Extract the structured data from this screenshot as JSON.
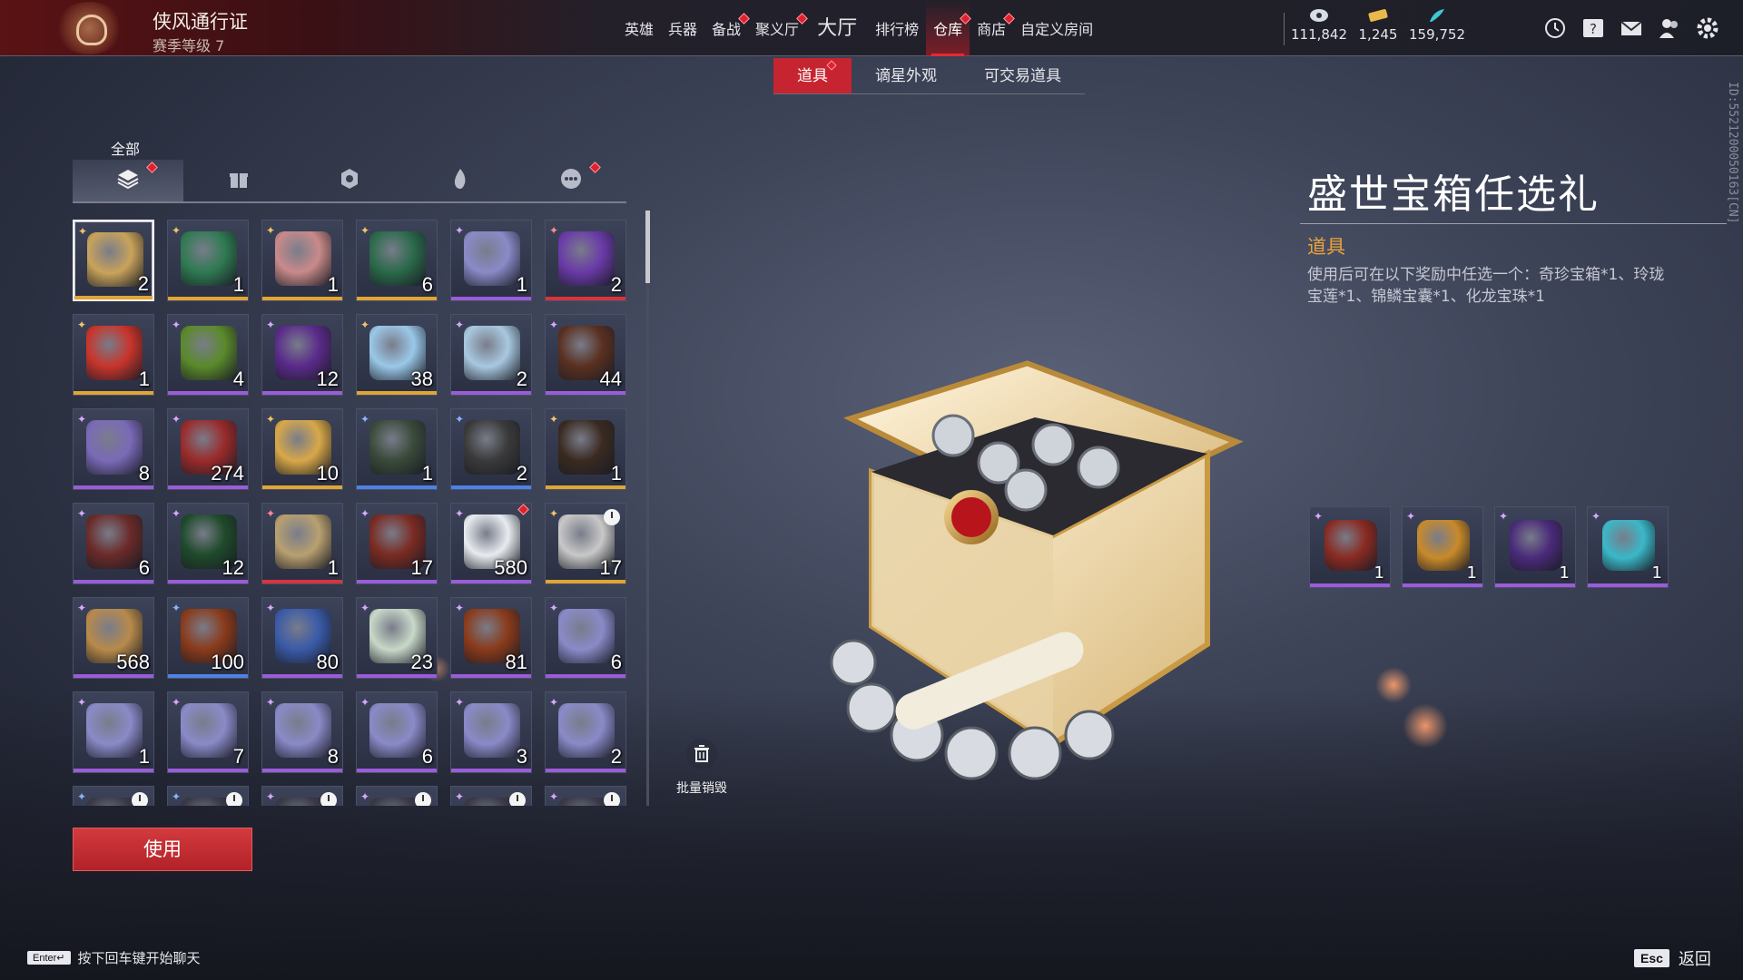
{
  "topbar": {
    "pass_title": "侠风通行证",
    "pass_level": "赛季等级 7",
    "nav": [
      {
        "label": "英雄",
        "dot": false,
        "big": false,
        "active": false
      },
      {
        "label": "兵器",
        "dot": false,
        "big": false,
        "active": false
      },
      {
        "label": "备战",
        "dot": true,
        "big": false,
        "active": false
      },
      {
        "label": "聚义厅",
        "dot": true,
        "big": false,
        "active": false
      },
      {
        "label": "大厅",
        "dot": false,
        "big": true,
        "active": false
      },
      {
        "label": "排行榜",
        "dot": false,
        "big": false,
        "active": false
      },
      {
        "label": "仓库",
        "dot": true,
        "big": false,
        "active": true
      },
      {
        "label": "商店",
        "dot": true,
        "big": false,
        "active": false
      },
      {
        "label": "自定义房间",
        "dot": false,
        "big": false,
        "active": false
      }
    ],
    "currencies": [
      {
        "icon": "jade-coin-icon",
        "value": "111,842"
      },
      {
        "icon": "gold-ticket-icon",
        "value": "1,245"
      },
      {
        "icon": "feather-icon",
        "value": "159,752"
      }
    ],
    "system_icons": [
      "clock-icon",
      "help-icon",
      "mail-icon",
      "friends-icon",
      "settings-icon"
    ]
  },
  "subtabs": [
    {
      "label": "道具",
      "active": true,
      "dot": true
    },
    {
      "label": "谪星外观",
      "active": false,
      "dot": false
    },
    {
      "label": "可交易道具",
      "active": false,
      "dot": false
    }
  ],
  "categories": {
    "active_label": "全部",
    "items": [
      {
        "icon": "all-items-stack-icon",
        "active": true,
        "dot": true
      },
      {
        "icon": "gift-icon",
        "active": false,
        "dot": false
      },
      {
        "icon": "badge-icon",
        "active": false,
        "dot": false
      },
      {
        "icon": "flame-icon",
        "active": false,
        "dot": false
      },
      {
        "icon": "more-icon",
        "active": false,
        "dot": true
      }
    ]
  },
  "inventory": [
    {
      "qty": "2",
      "rarity": "gold",
      "mark": "g",
      "color": "#c9a35a",
      "selected": true
    },
    {
      "qty": "1",
      "rarity": "gold",
      "mark": "g",
      "color": "#2f7a52"
    },
    {
      "qty": "1",
      "rarity": "gold",
      "mark": "g",
      "color": "#c98a8a"
    },
    {
      "qty": "6",
      "rarity": "gold",
      "mark": "g",
      "color": "#2a6a4a"
    },
    {
      "qty": "1",
      "rarity": "purple",
      "mark": "p",
      "color": "#8a8ac8"
    },
    {
      "qty": "2",
      "rarity": "red",
      "mark": "r",
      "color": "#6a3aa8"
    },
    {
      "qty": "1",
      "rarity": "gold",
      "mark": "g",
      "color": "#c8342a"
    },
    {
      "qty": "4",
      "rarity": "purple",
      "mark": "p",
      "color": "#5a8a2a"
    },
    {
      "qty": "12",
      "rarity": "purple",
      "mark": "p",
      "color": "#5a2a8a"
    },
    {
      "qty": "38",
      "rarity": "gold",
      "mark": "g",
      "color": "#9ac8e8"
    },
    {
      "qty": "2",
      "rarity": "purple",
      "mark": "p",
      "color": "#a8c8e0"
    },
    {
      "qty": "44",
      "rarity": "purple",
      "mark": "p",
      "color": "#5a3020"
    },
    {
      "qty": "8",
      "rarity": "purple",
      "mark": "p",
      "color": "#7a6ab8"
    },
    {
      "qty": "274",
      "rarity": "purple",
      "mark": "p",
      "color": "#9a2a2a"
    },
    {
      "qty": "10",
      "rarity": "gold",
      "mark": "g",
      "color": "#d8a848"
    },
    {
      "qty": "1",
      "rarity": "blue",
      "mark": "b",
      "color": "#3a4a3a"
    },
    {
      "qty": "2",
      "rarity": "blue",
      "mark": "b",
      "color": "#3a3a3a"
    },
    {
      "qty": "1",
      "rarity": "gold",
      "mark": "g",
      "color": "#3a2a20"
    },
    {
      "qty": "6",
      "rarity": "purple",
      "mark": "p",
      "color": "#6a2a28"
    },
    {
      "qty": "12",
      "rarity": "purple",
      "mark": "p",
      "color": "#1e4a2a"
    },
    {
      "qty": "1",
      "rarity": "red",
      "mark": "r",
      "color": "#b8a070"
    },
    {
      "qty": "17",
      "rarity": "purple",
      "mark": "p",
      "color": "#7a2a22"
    },
    {
      "qty": "580",
      "rarity": "purple",
      "mark": "p",
      "color": "#e8ecf0",
      "dot": true
    },
    {
      "qty": "17",
      "rarity": "gold",
      "mark": "g",
      "color": "#c8c8c8",
      "clock": true
    },
    {
      "qty": "568",
      "rarity": "purple",
      "mark": "p",
      "color": "#b88a4a"
    },
    {
      "qty": "100",
      "rarity": "blue",
      "mark": "b",
      "color": "#8a3a1a"
    },
    {
      "qty": "80",
      "rarity": "purple",
      "mark": "p",
      "color": "#3a5aa8"
    },
    {
      "qty": "23",
      "rarity": "purple",
      "mark": "p",
      "color": "#c8d8c8"
    },
    {
      "qty": "81",
      "rarity": "purple",
      "mark": "p",
      "color": "#8a3a1a"
    },
    {
      "qty": "6",
      "rarity": "purple",
      "mark": "p",
      "color": "#8a8ac8"
    },
    {
      "qty": "1",
      "rarity": "purple",
      "mark": "p",
      "color": "#8a8ac8"
    },
    {
      "qty": "7",
      "rarity": "purple",
      "mark": "p",
      "color": "#8a8ac8"
    },
    {
      "qty": "8",
      "rarity": "purple",
      "mark": "p",
      "color": "#8a8ac8"
    },
    {
      "qty": "6",
      "rarity": "purple",
      "mark": "p",
      "color": "#8a8ac8"
    },
    {
      "qty": "3",
      "rarity": "purple",
      "mark": "p",
      "color": "#8a8ac8"
    },
    {
      "qty": "2",
      "rarity": "purple",
      "mark": "p",
      "color": "#8a8ac8"
    },
    {
      "qty": "",
      "rarity": "blue",
      "mark": "b",
      "color": "#3a3a48",
      "clock": true
    },
    {
      "qty": "",
      "rarity": "blue",
      "mark": "b",
      "color": "#3a3a48",
      "clock": true
    },
    {
      "qty": "",
      "rarity": "purple",
      "mark": "p",
      "color": "#3a3a48",
      "clock": true
    },
    {
      "qty": "",
      "rarity": "purple",
      "mark": "p",
      "color": "#3a3a48",
      "clock": true
    },
    {
      "qty": "",
      "rarity": "purple",
      "mark": "p",
      "color": "#3a3a48",
      "clock": true
    },
    {
      "qty": "",
      "rarity": "purple",
      "mark": "p",
      "color": "#3a3a48",
      "clock": true
    }
  ],
  "use_button": "使用",
  "bulk_destroy": "批量销毁",
  "detail": {
    "name": "盛世宝箱任选礼",
    "type": "道具",
    "description": "使用后可在以下奖励中任选一个：奇珍宝箱*1、玲珑宝莲*1、锦鳞宝囊*1、化龙宝珠*1",
    "rewards": [
      {
        "qty": "1",
        "color": "#8a2a22"
      },
      {
        "qty": "1",
        "color": "#c88a2a"
      },
      {
        "qty": "1",
        "color": "#4a2a7a"
      },
      {
        "qty": "1",
        "color": "#3ab8c8"
      }
    ]
  },
  "uid": "ID:5521200050163[CN]",
  "chat_hint": {
    "key": "Enter↵",
    "text": "按下回车键开始聊天"
  },
  "back": {
    "key": "Esc",
    "text": "返回"
  }
}
